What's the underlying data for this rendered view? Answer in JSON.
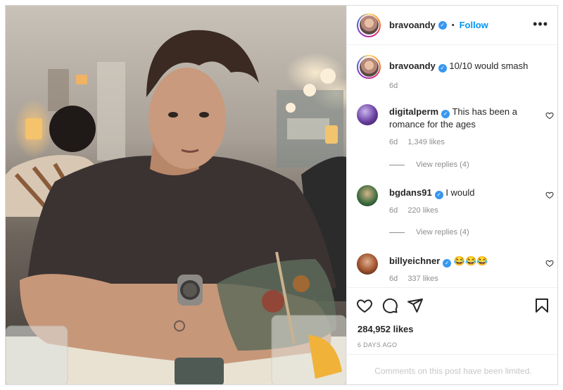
{
  "header": {
    "username": "bravoandy",
    "separator": "•",
    "follow_label": "Follow",
    "more_icon": "more-horizontal-icon"
  },
  "caption": {
    "username": "bravoandy",
    "text": "10/10 would smash",
    "age": "6d"
  },
  "comments": [
    {
      "username": "digitalperm",
      "text": "This has been a romance for the ages",
      "age": "6d",
      "likes": "1,349 likes",
      "replies": "View replies (4)",
      "avatar_color": "#6a3fa0"
    },
    {
      "username": "bgdans91",
      "text": "I would",
      "age": "6d",
      "likes": "220 likes",
      "replies": "View replies (4)",
      "avatar_color": "#3a6b3d"
    },
    {
      "username": "billyeichner",
      "text": "😂😂😂",
      "age": "6d",
      "likes": "337 likes",
      "avatar_color": "#a0522d"
    }
  ],
  "actions": {
    "like_icon": "heart-icon",
    "comment_icon": "comment-icon",
    "share_icon": "send-icon",
    "save_icon": "bookmark-icon",
    "likes_count": "284,952 likes",
    "date": "6 DAYS AGO"
  },
  "footer": {
    "limited_text": "Comments on this post have been limited."
  },
  "colors": {
    "accent": "#0095f6",
    "verified": "#3897f0",
    "muted": "#8e8e8e",
    "border": "#efefef"
  }
}
